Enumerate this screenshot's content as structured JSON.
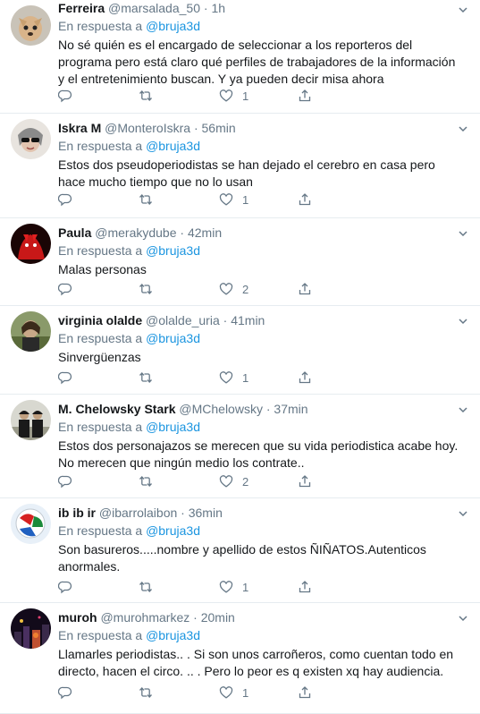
{
  "reply_prefix": "En respuesta a",
  "tweets": [
    {
      "name": "Ferreira",
      "handle": "@marsalada_50",
      "dot": "·",
      "time": "1h",
      "reply_to": "@bruja3d",
      "text": "No sé quién es el encargado de seleccionar a los reporteros del programa pero está claro qué perfiles de trabajadores de la información y el entretenimiento buscan. Y ya pueden decir misa ahora",
      "likes": "1"
    },
    {
      "name": "Iskra M",
      "handle": "@MonteroIskra",
      "dot": "·",
      "time": "56min",
      "reply_to": "@bruja3d",
      "text": "Estos dos pseudoperiodistas se han dejado el cerebro en casa pero hace mucho tiempo que no lo usan",
      "likes": "1"
    },
    {
      "name": "Paula",
      "handle": "@merakydube",
      "dot": "·",
      "time": "42min",
      "reply_to": "@bruja3d",
      "text": "Malas personas",
      "likes": "2"
    },
    {
      "name": "virginia olalde",
      "handle": "@olalde_uria",
      "dot": "·",
      "time": "41min",
      "reply_to": "@bruja3d",
      "text": "Sinvergüenzas",
      "likes": "1"
    },
    {
      "name": "M. Chelowsky Stark",
      "handle": "@MChelowsky",
      "dot": "·",
      "time": "37min",
      "reply_to": "@bruja3d",
      "text": "Estos dos personajazos se merecen que su vida periodistica acabe hoy. No merecen que ningún medio los contrate..",
      "likes": "2"
    },
    {
      "name": "ib ib ir",
      "handle": "@ibarrolaibon",
      "dot": "·",
      "time": "36min",
      "reply_to": "@bruja3d",
      "text": "Son basureros.....nombre y apellido de estos ÑIÑATOS.Autenticos anormales.",
      "likes": "1"
    },
    {
      "name": "muroh",
      "handle": "@murohmarkez",
      "dot": "·",
      "time": "20min",
      "reply_to": "@bruja3d",
      "text": "Llamarles periodistas.. . Si son unos carroñeros, como cuentan todo en directo, hacen el circo. .. . Pero lo peor es q existen xq hay audiencia.",
      "likes": "1"
    }
  ],
  "colors": {
    "link": "#1b95e0",
    "muted": "#657786",
    "text": "#14171a",
    "divider": "#e6ecf0"
  },
  "icons": [
    "reply-icon",
    "retweet-icon",
    "like-icon",
    "share-icon",
    "chevron-down-icon"
  ]
}
